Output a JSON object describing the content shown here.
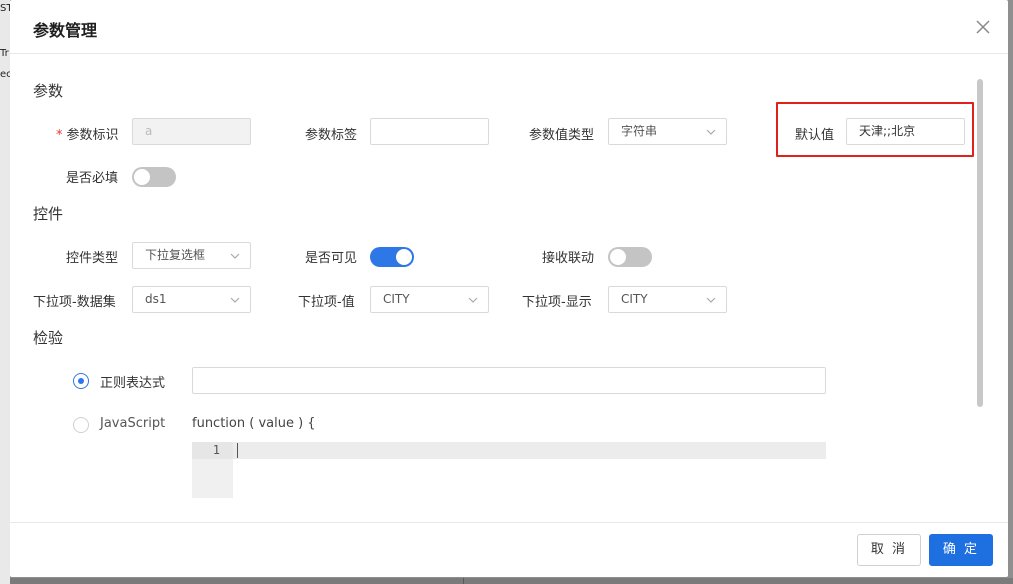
{
  "background": {
    "edge_texts": [
      "ST",
      "Tr",
      "ec"
    ]
  },
  "dialog": {
    "title": "参数管理",
    "close_icon": "close-icon"
  },
  "sections": {
    "params": "参数",
    "controls": "控件",
    "validation": "检验"
  },
  "params": {
    "id_label": "参数标识",
    "id_required_mark": "*",
    "id_value": "a",
    "tag_label": "参数标签",
    "tag_value": "",
    "value_type_label": "参数值类型",
    "value_type_value": "字符串",
    "default_label": "默认值",
    "default_value": "天津;;北京",
    "required_label": "是否必填",
    "required_on": false
  },
  "controls": {
    "type_label": "控件类型",
    "type_value": "下拉复选框",
    "visible_label": "是否可见",
    "visible_on": true,
    "linkage_label": "接收联动",
    "linkage_on": false,
    "dataset_label": "下拉项-数据集",
    "dataset_value": "ds1",
    "value_field_label": "下拉项-值",
    "value_field_value": "CITY",
    "display_field_label": "下拉项-显示",
    "display_field_value": "CITY"
  },
  "validation": {
    "regex_label": "正则表达式",
    "regex_checked": true,
    "regex_value": "",
    "js_label": "JavaScript",
    "js_checked": false,
    "function_signature": "function ( value ) {",
    "line_number": "1",
    "code": ""
  },
  "footer": {
    "cancel_label": "取 消",
    "ok_label": "确 定"
  },
  "colors": {
    "primary": "#1e6fe0",
    "toggle_on": "#2d78e6",
    "highlight": "#e0201b",
    "required": "#e53935"
  },
  "icons": {
    "select_chevron": "chevron-down-icon"
  }
}
